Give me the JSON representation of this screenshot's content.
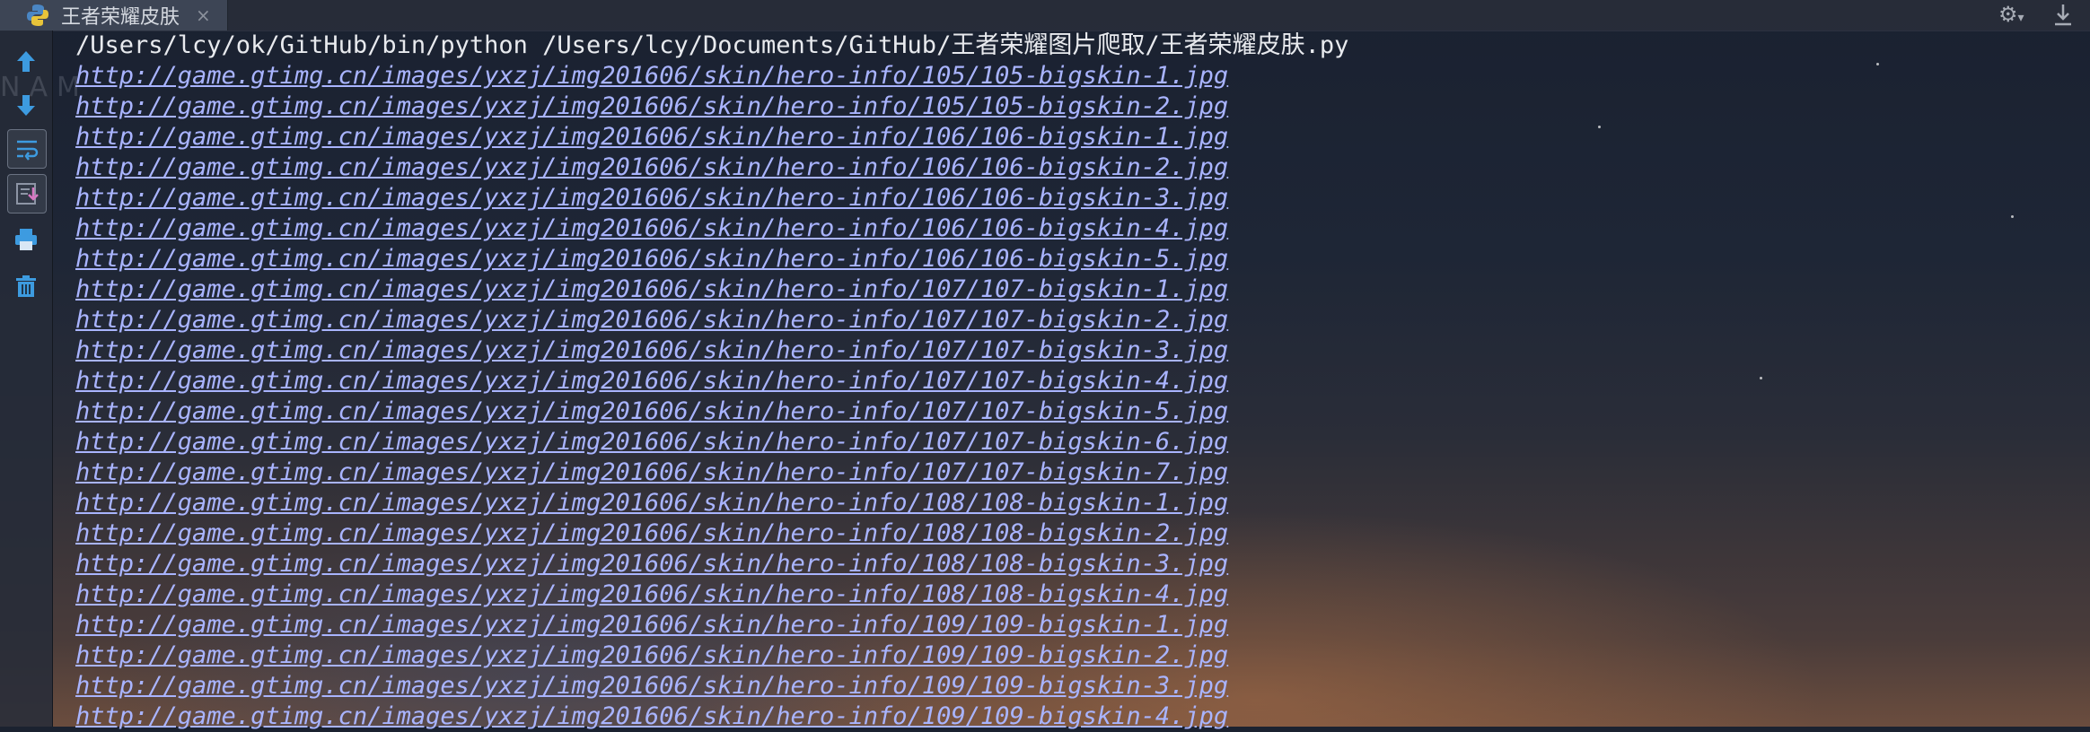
{
  "tab": {
    "title": "王者荣耀皮肤",
    "close": "×"
  },
  "watermark": "NAM",
  "console": {
    "command": "/Users/lcy/ok/GitHub/bin/python /Users/lcy/Documents/GitHub/王者荣耀图片爬取/王者荣耀皮肤.py",
    "lines": [
      "http://game.gtimg.cn/images/yxzj/img201606/skin/hero-info/105/105-bigskin-1.jpg",
      "http://game.gtimg.cn/images/yxzj/img201606/skin/hero-info/105/105-bigskin-2.jpg",
      "http://game.gtimg.cn/images/yxzj/img201606/skin/hero-info/106/106-bigskin-1.jpg",
      "http://game.gtimg.cn/images/yxzj/img201606/skin/hero-info/106/106-bigskin-2.jpg",
      "http://game.gtimg.cn/images/yxzj/img201606/skin/hero-info/106/106-bigskin-3.jpg",
      "http://game.gtimg.cn/images/yxzj/img201606/skin/hero-info/106/106-bigskin-4.jpg",
      "http://game.gtimg.cn/images/yxzj/img201606/skin/hero-info/106/106-bigskin-5.jpg",
      "http://game.gtimg.cn/images/yxzj/img201606/skin/hero-info/107/107-bigskin-1.jpg",
      "http://game.gtimg.cn/images/yxzj/img201606/skin/hero-info/107/107-bigskin-2.jpg",
      "http://game.gtimg.cn/images/yxzj/img201606/skin/hero-info/107/107-bigskin-3.jpg",
      "http://game.gtimg.cn/images/yxzj/img201606/skin/hero-info/107/107-bigskin-4.jpg",
      "http://game.gtimg.cn/images/yxzj/img201606/skin/hero-info/107/107-bigskin-5.jpg",
      "http://game.gtimg.cn/images/yxzj/img201606/skin/hero-info/107/107-bigskin-6.jpg",
      "http://game.gtimg.cn/images/yxzj/img201606/skin/hero-info/107/107-bigskin-7.jpg",
      "http://game.gtimg.cn/images/yxzj/img201606/skin/hero-info/108/108-bigskin-1.jpg",
      "http://game.gtimg.cn/images/yxzj/img201606/skin/hero-info/108/108-bigskin-2.jpg",
      "http://game.gtimg.cn/images/yxzj/img201606/skin/hero-info/108/108-bigskin-3.jpg",
      "http://game.gtimg.cn/images/yxzj/img201606/skin/hero-info/108/108-bigskin-4.jpg",
      "http://game.gtimg.cn/images/yxzj/img201606/skin/hero-info/109/109-bigskin-1.jpg",
      "http://game.gtimg.cn/images/yxzj/img201606/skin/hero-info/109/109-bigskin-2.jpg",
      "http://game.gtimg.cn/images/yxzj/img201606/skin/hero-info/109/109-bigskin-3.jpg",
      "http://game.gtimg.cn/images/yxzj/img201606/skin/hero-info/109/109-bigskin-4.jpg"
    ]
  },
  "toolbar": {
    "icons": [
      "arrow-up-icon",
      "arrow-down-icon",
      "soft-wrap-icon",
      "scroll-to-end-icon",
      "print-icon",
      "trash-icon"
    ]
  },
  "colors": {
    "link": "#a9b4ff",
    "text": "#e8eaee",
    "icon_blue": "#3d9be0"
  }
}
